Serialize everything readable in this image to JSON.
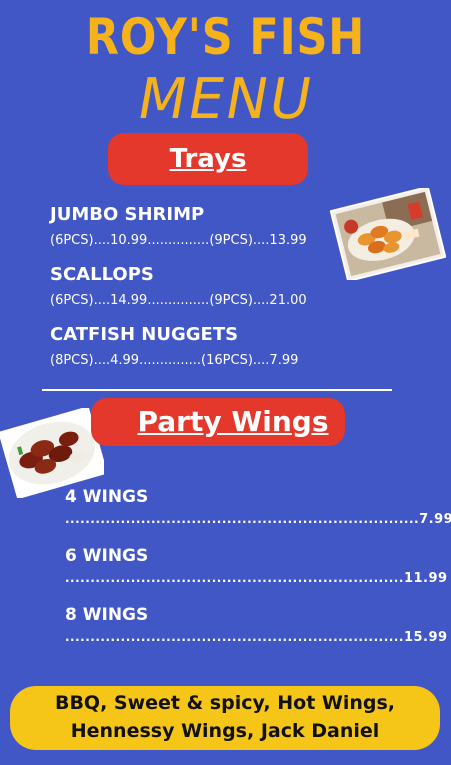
{
  "header": {
    "title": "ROY'S FISH",
    "subtitle": "MENU"
  },
  "trays": {
    "heading": "Trays",
    "items": [
      {
        "name": "JUMBO SHRIMP",
        "price_line": "(6PCS)....10.99...............(9PCS)....13.99"
      },
      {
        "name": "SCALLOPS",
        "price_line": "(6PCS)....14.99...............(9PCS)....21.00"
      },
      {
        "name": "CATFISH NUGGETS",
        "price_line": "(8PCS)....4.99...............(16PCS)....7.99"
      }
    ]
  },
  "wings": {
    "heading": "Party Wings",
    "items": [
      {
        "name": "4 WINGS",
        "leader": "......................................................................",
        "price": "7.99"
      },
      {
        "name": "6 WINGS",
        "leader": "...................................................................",
        "price": "11.99"
      },
      {
        "name": "8 WINGS",
        "leader": "...................................................................",
        "price": "15.99"
      }
    ]
  },
  "flavors": {
    "line1": "BBQ, Sweet & spicy, Hot Wings,",
    "line2": "Hennessy Wings, Jack Daniel"
  },
  "colors": {
    "background": "#4257c6",
    "title": "#f6b21a",
    "pill": "#e3382b",
    "banner": "#f5c518"
  }
}
